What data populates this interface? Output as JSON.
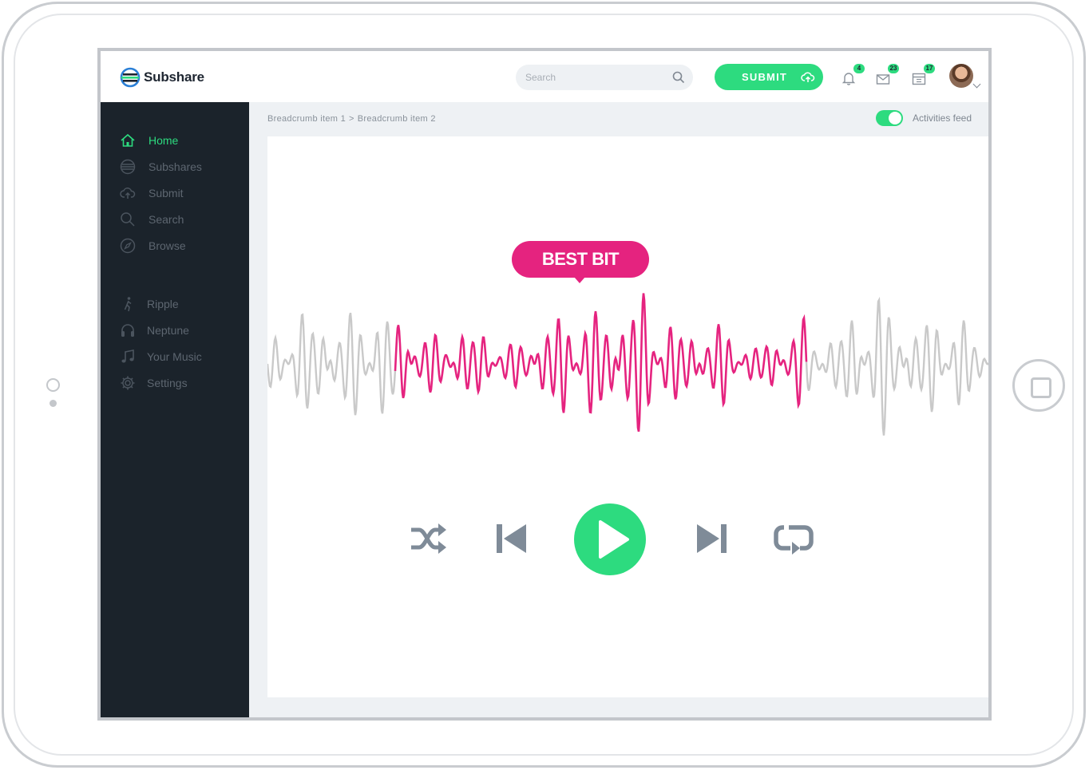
{
  "app": {
    "name": "Subshare"
  },
  "header": {
    "search_placeholder": "Search",
    "submit_label": "SUBMIT",
    "notifications_count": "4",
    "messages_count": "23",
    "calendar_count": "17"
  },
  "sidebar": {
    "primary": [
      {
        "label": "Home",
        "icon": "home-icon",
        "active": true
      },
      {
        "label": "Subshares",
        "icon": "subshares-icon"
      },
      {
        "label": "Submit",
        "icon": "upload-cloud-icon"
      },
      {
        "label": "Search",
        "icon": "search-icon"
      },
      {
        "label": "Browse",
        "icon": "compass-icon"
      }
    ],
    "secondary": [
      {
        "label": "Ripple",
        "icon": "runner-icon"
      },
      {
        "label": "Neptune",
        "icon": "headphones-icon"
      },
      {
        "label": "Your Music",
        "icon": "music-note-icon"
      },
      {
        "label": "Settings",
        "icon": "gear-icon"
      }
    ]
  },
  "breadcrumb": [
    "Breadcrumb item 1",
    "Breadcrumb item 2"
  ],
  "breadcrumb_separator": ">",
  "activities_feed": {
    "label": "Activities feed",
    "enabled": true
  },
  "player": {
    "highlight_label": "BEST BIT",
    "controls": [
      "shuffle-icon",
      "previous-icon",
      "play-icon",
      "next-icon",
      "repeat-icon"
    ]
  },
  "colors": {
    "accent": "#2ddb7f",
    "highlight": "#e5237f",
    "sidebar_bg": "#1b232b",
    "wave_inactive": "#c9c9c9",
    "control_icon": "#7f8b98"
  }
}
